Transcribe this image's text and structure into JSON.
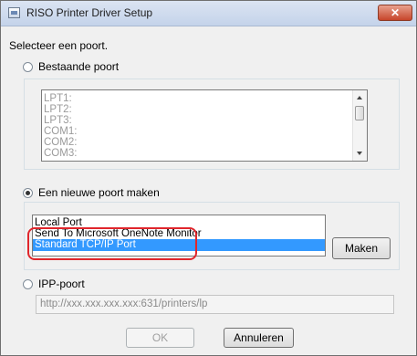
{
  "window": {
    "title": "RISO Printer Driver Setup",
    "close_glyph": "✕"
  },
  "instruction": "Selecteer een poort.",
  "existing_port": {
    "label": "Bestaande poort",
    "items": [
      "LPT1:",
      "LPT2:",
      "LPT3:",
      "COM1:",
      "COM2:",
      "COM3:"
    ]
  },
  "new_port": {
    "label": "Een nieuwe poort maken",
    "items": [
      "Local Port",
      "Send To Microsoft OneNote Monitor",
      "Standard TCP/IP Port"
    ],
    "selected_index": 2,
    "create_button": "Maken"
  },
  "ipp_port": {
    "label": "IPP-poort",
    "url_value": "http://xxx.xxx.xxx.xxx:631/printers/lp"
  },
  "buttons": {
    "ok": "OK",
    "cancel": "Annuleren"
  },
  "colors": {
    "selection": "#3399ff",
    "annotation_ring": "#e0262c"
  }
}
